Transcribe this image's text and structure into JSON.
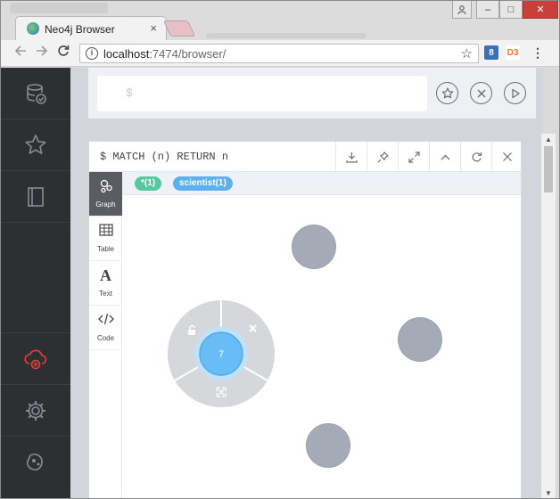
{
  "window": {
    "tab_title": "Neo4j Browser",
    "tab_close": "×",
    "minimize": "‒",
    "maximize": "□",
    "close": "✕"
  },
  "toolbar": {
    "url_host": "localhost",
    "url_path": ":7474/browser/",
    "back_icon": "arrow-left-icon",
    "forward_icon": "arrow-right-icon",
    "reload_icon": "reload-icon",
    "extensions": [
      {
        "name": "bitwarden-icon",
        "label": "8",
        "color": "#3b6fb6"
      },
      {
        "name": "d3-icon",
        "label": "D3",
        "color": "#e8762d"
      }
    ]
  },
  "sidebar": {
    "items": [
      {
        "name": "database-icon",
        "color": "#8a8c92"
      },
      {
        "name": "favorites-star-icon",
        "color": "#8a8c92"
      },
      {
        "name": "documents-book-icon",
        "color": "#8a8c92"
      },
      {
        "name": "cloud-disconnected-icon",
        "color": "#e0413c"
      },
      {
        "name": "settings-gear-icon",
        "color": "#8a8c92"
      },
      {
        "name": "about-neo4j-icon",
        "color": "#8a8c92"
      }
    ]
  },
  "editor": {
    "prompt": "$",
    "buttons": [
      "favorite-star-icon",
      "clear-x-icon",
      "run-play-icon"
    ]
  },
  "frame": {
    "query": "$ MATCH (n) RETURN n",
    "header_buttons": [
      "download-icon",
      "pin-icon",
      "fullscreen-icon",
      "collapse-icon",
      "rerun-icon",
      "close-icon"
    ],
    "tabs": [
      {
        "label": "Graph",
        "icon": "graph-icon"
      },
      {
        "label": "Table",
        "icon": "table-icon"
      },
      {
        "label": "Text",
        "icon": "text-icon"
      },
      {
        "label": "Code",
        "icon": "code-icon"
      }
    ],
    "legend": [
      {
        "label": "*(1)",
        "color": "#57c7a0"
      },
      {
        "label": "scientist(1)",
        "color": "#5db0ec"
      }
    ]
  },
  "graph": {
    "selected_node_label": "7",
    "selected_node_color": "#68bdf6",
    "node_color": "#a5abb6",
    "ring_actions": [
      "unlock-icon",
      "remove-x-icon",
      "expand-icon"
    ]
  }
}
